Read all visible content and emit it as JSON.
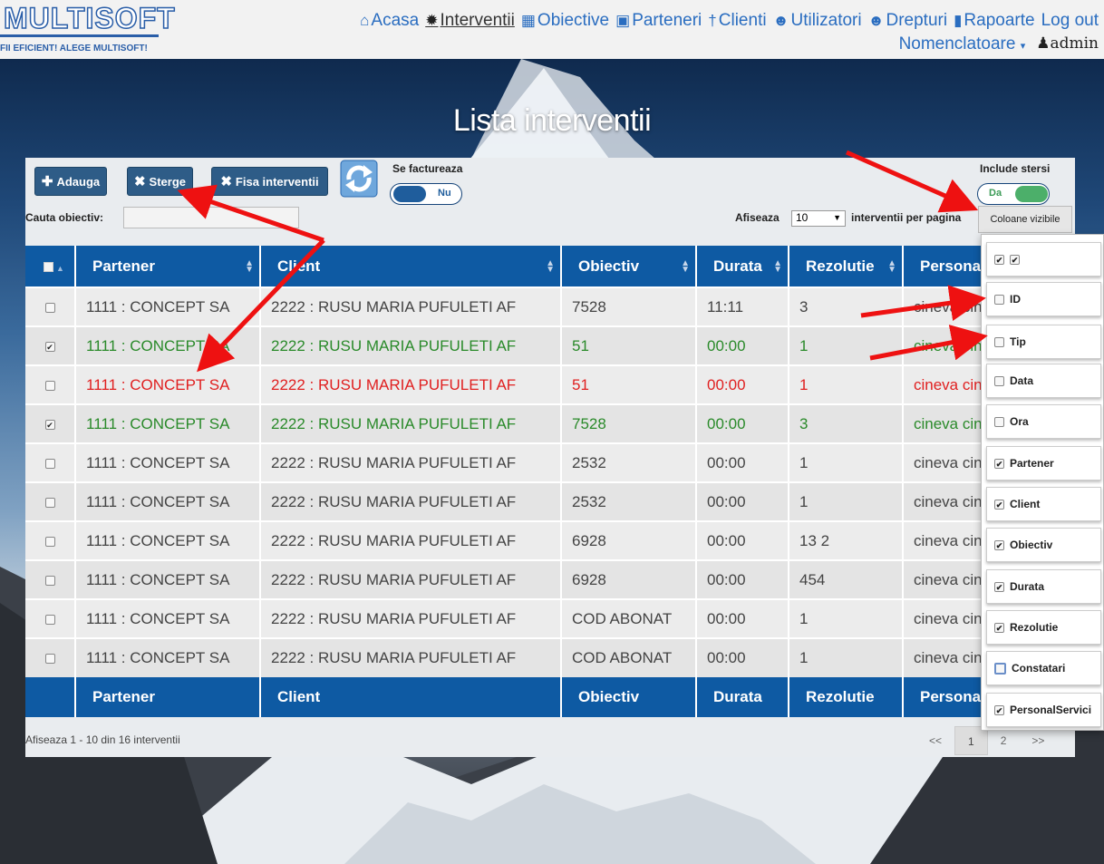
{
  "app": {
    "logo_main": "MULTISOFT",
    "logo_tag_normal": "FII EFICIENT! ",
    "logo_tag_bold": "ALEGE MULTISOFT!"
  },
  "nav": {
    "items": [
      {
        "label": "Acasa",
        "icon": "home-icon",
        "glyph": "⌂"
      },
      {
        "label": "Interventii",
        "icon": "gear-icon",
        "glyph": "✹"
      },
      {
        "label": "Obiective",
        "icon": "building-icon",
        "glyph": "▦"
      },
      {
        "label": "Parteneri",
        "icon": "briefcase-icon",
        "glyph": "▣"
      },
      {
        "label": "Clienti",
        "icon": "user-icon",
        "glyph": "†"
      },
      {
        "label": "Utilizatori",
        "icon": "users-icon",
        "glyph": "☻"
      },
      {
        "label": "Drepturi",
        "icon": "users-icon",
        "glyph": "☻"
      },
      {
        "label": "Rapoarte",
        "icon": "book-icon",
        "glyph": "▮"
      }
    ],
    "logout": "Log out",
    "nomenclatoare": "Nomenclatoare",
    "admin": "admin"
  },
  "page": {
    "title": "Lista interventii"
  },
  "toolbar": {
    "add_label": "Adauga",
    "delete_label": "Sterge",
    "fisa_label": "Fisa interventii",
    "se_factureaza_label": "Se factureaza",
    "se_factureaza_value": "Nu",
    "include_stersi_label": "Include stersi",
    "include_stersi_value": "Da",
    "search_label": "Cauta obiectiv:",
    "search_value": "",
    "perpage_prefix": "Afiseaza",
    "perpage_value": "10",
    "perpage_suffix": "interventii per pagina",
    "columns_button": "Coloane vizibile"
  },
  "table": {
    "headers": [
      "Partener",
      "Client",
      "Obiectiv",
      "Durata",
      "Rezolutie",
      "Persona"
    ],
    "rows": [
      {
        "checked": false,
        "status": "normal",
        "cells": [
          "1111 : CONCEPT SA",
          "2222 : RUSU MARIA PUFULETI AF",
          "7528",
          "11:11",
          "3",
          "cineva cin"
        ]
      },
      {
        "checked": true,
        "status": "green",
        "cells": [
          "1111 : CONCEPT SA",
          "2222 : RUSU MARIA PUFULETI AF",
          "51",
          "00:00",
          "1",
          "cineva cin"
        ]
      },
      {
        "checked": false,
        "status": "red",
        "cells": [
          "1111 : CONCEPT SA",
          "2222 : RUSU MARIA PUFULETI AF",
          "51",
          "00:00",
          "1",
          "cineva cin"
        ]
      },
      {
        "checked": true,
        "status": "green",
        "cells": [
          "1111 : CONCEPT SA",
          "2222 : RUSU MARIA PUFULETI AF",
          "7528",
          "00:00",
          "3",
          "cineva cin"
        ]
      },
      {
        "checked": false,
        "status": "normal",
        "cells": [
          "1111 : CONCEPT SA",
          "2222 : RUSU MARIA PUFULETI AF",
          "2532",
          "00:00",
          "1",
          "cineva cin"
        ]
      },
      {
        "checked": false,
        "status": "normal",
        "cells": [
          "1111 : CONCEPT SA",
          "2222 : RUSU MARIA PUFULETI AF",
          "2532",
          "00:00",
          "1",
          "cineva cin"
        ]
      },
      {
        "checked": false,
        "status": "normal",
        "cells": [
          "1111 : CONCEPT SA",
          "2222 : RUSU MARIA PUFULETI AF",
          "6928",
          "00:00",
          "13 2",
          "cineva cin"
        ]
      },
      {
        "checked": false,
        "status": "normal",
        "cells": [
          "1111 : CONCEPT SA",
          "2222 : RUSU MARIA PUFULETI AF",
          "6928",
          "00:00",
          "454",
          "cineva cin"
        ]
      },
      {
        "checked": false,
        "status": "normal",
        "cells": [
          "1111 : CONCEPT SA",
          "2222 : RUSU MARIA PUFULETI AF",
          "COD ABONAT",
          "00:00",
          "1",
          "cineva cin"
        ]
      },
      {
        "checked": false,
        "status": "normal",
        "cells": [
          "1111 : CONCEPT SA",
          "2222 : RUSU MARIA PUFULETI AF",
          "COD ABONAT",
          "00:00",
          "1",
          "cineva cin"
        ]
      }
    ],
    "info": "Afiseaza 1 - 10 din 16 interventii",
    "pager": {
      "prev": "<<",
      "pages": [
        "1",
        "2"
      ],
      "current": "1",
      "next": ">>"
    }
  },
  "columns_menu": [
    {
      "label": "",
      "checked": true
    },
    {
      "label": "ID",
      "checked": false
    },
    {
      "label": "Tip",
      "checked": false
    },
    {
      "label": "Data",
      "checked": false
    },
    {
      "label": "Ora",
      "checked": false
    },
    {
      "label": "Partener",
      "checked": true
    },
    {
      "label": "Client",
      "checked": true
    },
    {
      "label": "Obiectiv",
      "checked": true
    },
    {
      "label": "Durata",
      "checked": true
    },
    {
      "label": "Rezolutie",
      "checked": true
    },
    {
      "label": "Constatari",
      "checked": false
    },
    {
      "label": "PersonalServici",
      "checked": true
    }
  ],
  "colors": {
    "nav_link": "#2a6dc0",
    "header_bg": "#0e5aa3",
    "button_bg": "#2e5c87",
    "row_green": "#2a8a2a",
    "row_red": "#e02020",
    "annotation_arrow": "#ee1111"
  }
}
